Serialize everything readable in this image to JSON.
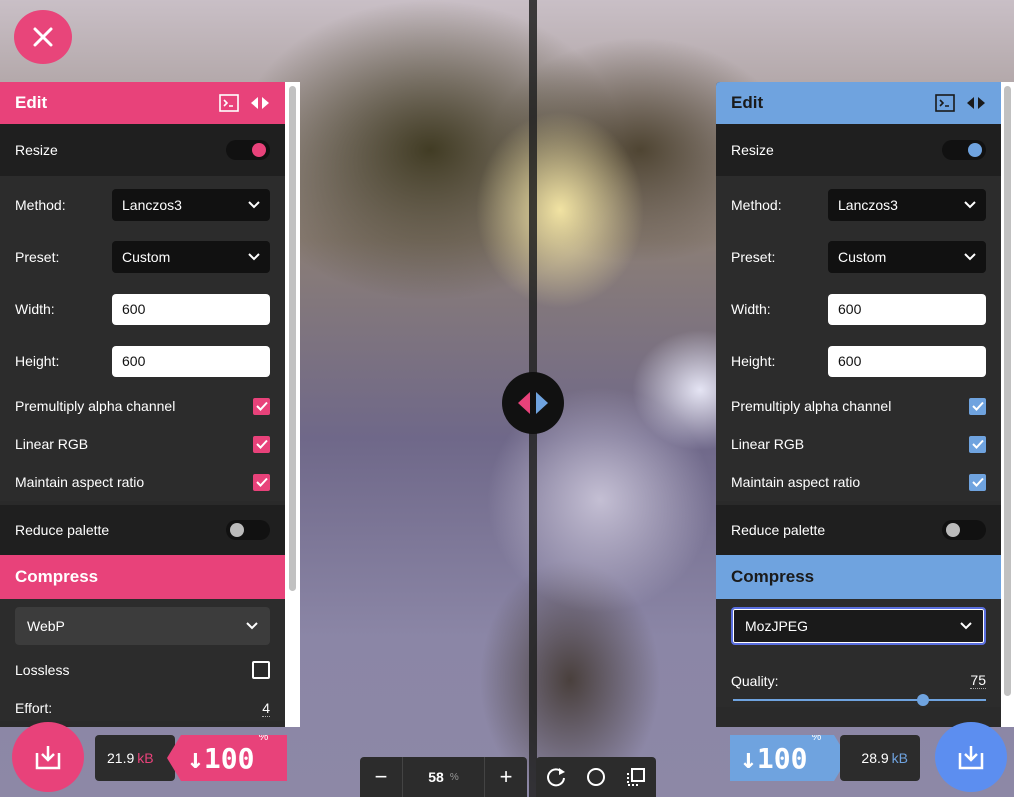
{
  "left_panel": {
    "header": "Edit",
    "resize_label": "Resize",
    "method_label": "Method:",
    "method_value": "Lanczos3",
    "preset_label": "Preset:",
    "preset_value": "Custom",
    "width_label": "Width:",
    "width_value": "600",
    "height_label": "Height:",
    "height_value": "600",
    "premultiply_label": "Premultiply alpha channel",
    "linear_rgb_label": "Linear RGB",
    "aspect_label": "Maintain aspect ratio",
    "reduce_label": "Reduce palette",
    "compress_header": "Compress",
    "codec_value": "WebP",
    "lossless_label": "Lossless",
    "effort_label": "Effort:",
    "effort_value": "4"
  },
  "right_panel": {
    "header": "Edit",
    "resize_label": "Resize",
    "method_label": "Method:",
    "method_value": "Lanczos3",
    "preset_label": "Preset:",
    "preset_value": "Custom",
    "width_label": "Width:",
    "width_value": "600",
    "height_label": "Height:",
    "height_value": "600",
    "premultiply_label": "Premultiply alpha channel",
    "linear_rgb_label": "Linear RGB",
    "aspect_label": "Maintain aspect ratio",
    "reduce_label": "Reduce palette",
    "compress_header": "Compress",
    "codec_value": "MozJPEG",
    "quality_label": "Quality:",
    "quality_value": "75",
    "quality_fraction": 0.75
  },
  "footer": {
    "left_size": "21.9",
    "left_size_unit": "kB",
    "left_percent": "↓100",
    "left_percent_unit": "%",
    "right_size": "28.9",
    "right_size_unit": "kB",
    "right_percent": "↓100",
    "right_percent_unit": "%",
    "zoom_value": "58",
    "zoom_unit": "%",
    "zoom_out": "−",
    "zoom_in": "+"
  },
  "colors": {
    "left_accent": "#e8427a",
    "right_accent": "#6fa3df",
    "panel_bg": "#2a2a2a"
  },
  "icons": [
    "close-icon",
    "swap-arrows-icon",
    "terminal-icon",
    "expand-arrows-icon",
    "chevron-down-icon",
    "checkmark-icon",
    "download-icon",
    "rotate-icon",
    "circle-icon",
    "copy-settings-icon"
  ]
}
